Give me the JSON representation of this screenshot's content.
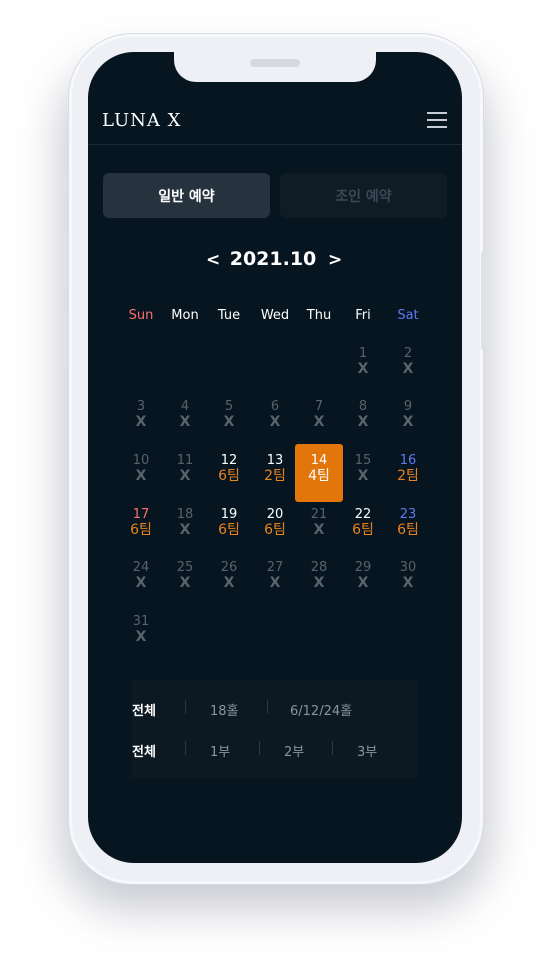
{
  "header": {
    "logo": "LUNA X",
    "menu_icon": "hamburger-menu-icon"
  },
  "tabs": [
    {
      "label": "일반 예약",
      "active": true
    },
    {
      "label": "조인 예약",
      "active": false
    }
  ],
  "calendar": {
    "prev_label": "<",
    "next_label": ">",
    "month_label": "2021.10",
    "weekdays": [
      "Sun",
      "Mon",
      "Tue",
      "Wed",
      "Thu",
      "Fri",
      "Sat"
    ],
    "weeks": [
      [
        null,
        null,
        null,
        null,
        null,
        {
          "day": "1",
          "status": "X",
          "available": false
        },
        {
          "day": "2",
          "status": "X",
          "available": false
        }
      ],
      [
        {
          "day": "3",
          "status": "X",
          "available": false
        },
        {
          "day": "4",
          "status": "X",
          "available": false
        },
        {
          "day": "5",
          "status": "X",
          "available": false
        },
        {
          "day": "6",
          "status": "X",
          "available": false
        },
        {
          "day": "7",
          "status": "X",
          "available": false
        },
        {
          "day": "8",
          "status": "X",
          "available": false
        },
        {
          "day": "9",
          "status": "X",
          "available": false
        }
      ],
      [
        {
          "day": "10",
          "status": "X",
          "available": false
        },
        {
          "day": "11",
          "status": "X",
          "available": false
        },
        {
          "day": "12",
          "status": "6팀",
          "available": true
        },
        {
          "day": "13",
          "status": "2팀",
          "available": true
        },
        {
          "day": "14",
          "status": "4팀",
          "available": true,
          "selected": true
        },
        {
          "day": "15",
          "status": "X",
          "available": false
        },
        {
          "day": "16",
          "status": "2팀",
          "available": true
        }
      ],
      [
        {
          "day": "17",
          "status": "6팀",
          "available": true
        },
        {
          "day": "18",
          "status": "X",
          "available": false
        },
        {
          "day": "19",
          "status": "6팀",
          "available": true
        },
        {
          "day": "20",
          "status": "6팀",
          "available": true
        },
        {
          "day": "21",
          "status": "X",
          "available": false
        },
        {
          "day": "22",
          "status": "6팀",
          "available": true
        },
        {
          "day": "23",
          "status": "6팀",
          "available": true
        }
      ],
      [
        {
          "day": "24",
          "status": "X",
          "available": false
        },
        {
          "day": "25",
          "status": "X",
          "available": false
        },
        {
          "day": "26",
          "status": "X",
          "available": false
        },
        {
          "day": "27",
          "status": "X",
          "available": false
        },
        {
          "day": "28",
          "status": "X",
          "available": false
        },
        {
          "day": "29",
          "status": "X",
          "available": false
        },
        {
          "day": "30",
          "status": "X",
          "available": false
        }
      ],
      [
        {
          "day": "31",
          "status": "X",
          "available": false
        },
        null,
        null,
        null,
        null,
        null,
        null
      ]
    ]
  },
  "filters": {
    "holes": {
      "label": "전체",
      "options": [
        "18홀",
        "6/12/24홀"
      ]
    },
    "parts": {
      "label": "전체",
      "options": [
        "1부",
        "2부",
        "3부"
      ]
    }
  },
  "colors": {
    "background": "#061520",
    "accent": "#e2760a",
    "available_text": "#e8831e",
    "sunday": "#ff6f6f",
    "saturday": "#5d7af0"
  }
}
